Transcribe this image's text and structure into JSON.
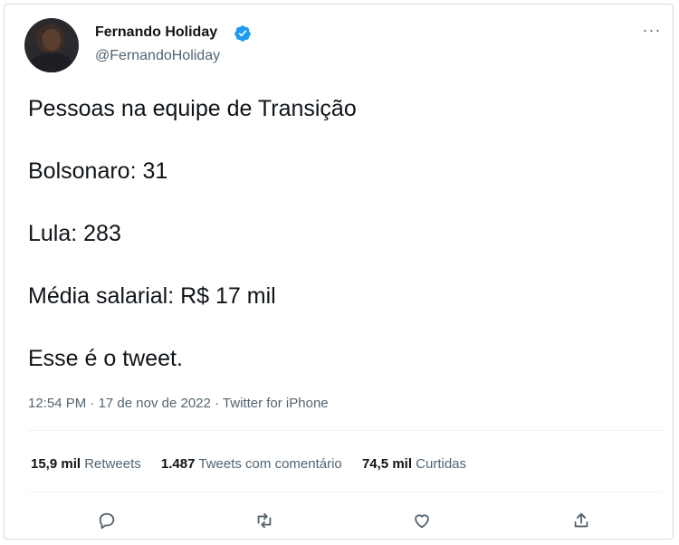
{
  "author": {
    "display_name": "Fernando Holiday",
    "handle": "@FernandoHoliday",
    "verified": true
  },
  "tweet": {
    "lines": [
      "Pessoas na equipe de Transição",
      "Bolsonaro: 31",
      "Lula: 283",
      "Média salarial: R$ 17 mil",
      "Esse é o tweet."
    ],
    "time": "12:54 PM",
    "date": "17 de nov de 2022",
    "source": "Twitter for iPhone",
    "separator": "·"
  },
  "stats": [
    {
      "value": "15,9 mil",
      "label": "Retweets"
    },
    {
      "value": "1.487",
      "label": "Tweets com comentário"
    },
    {
      "value": "74,5 mil",
      "label": "Curtidas"
    }
  ],
  "actions": [
    "reply-icon",
    "retweet-icon",
    "like-icon",
    "share-icon"
  ],
  "more_label": "···",
  "colors": {
    "text": "#0f1419",
    "secondary": "#536471",
    "verified": "#1d9bf0",
    "border": "#cfd9de"
  }
}
